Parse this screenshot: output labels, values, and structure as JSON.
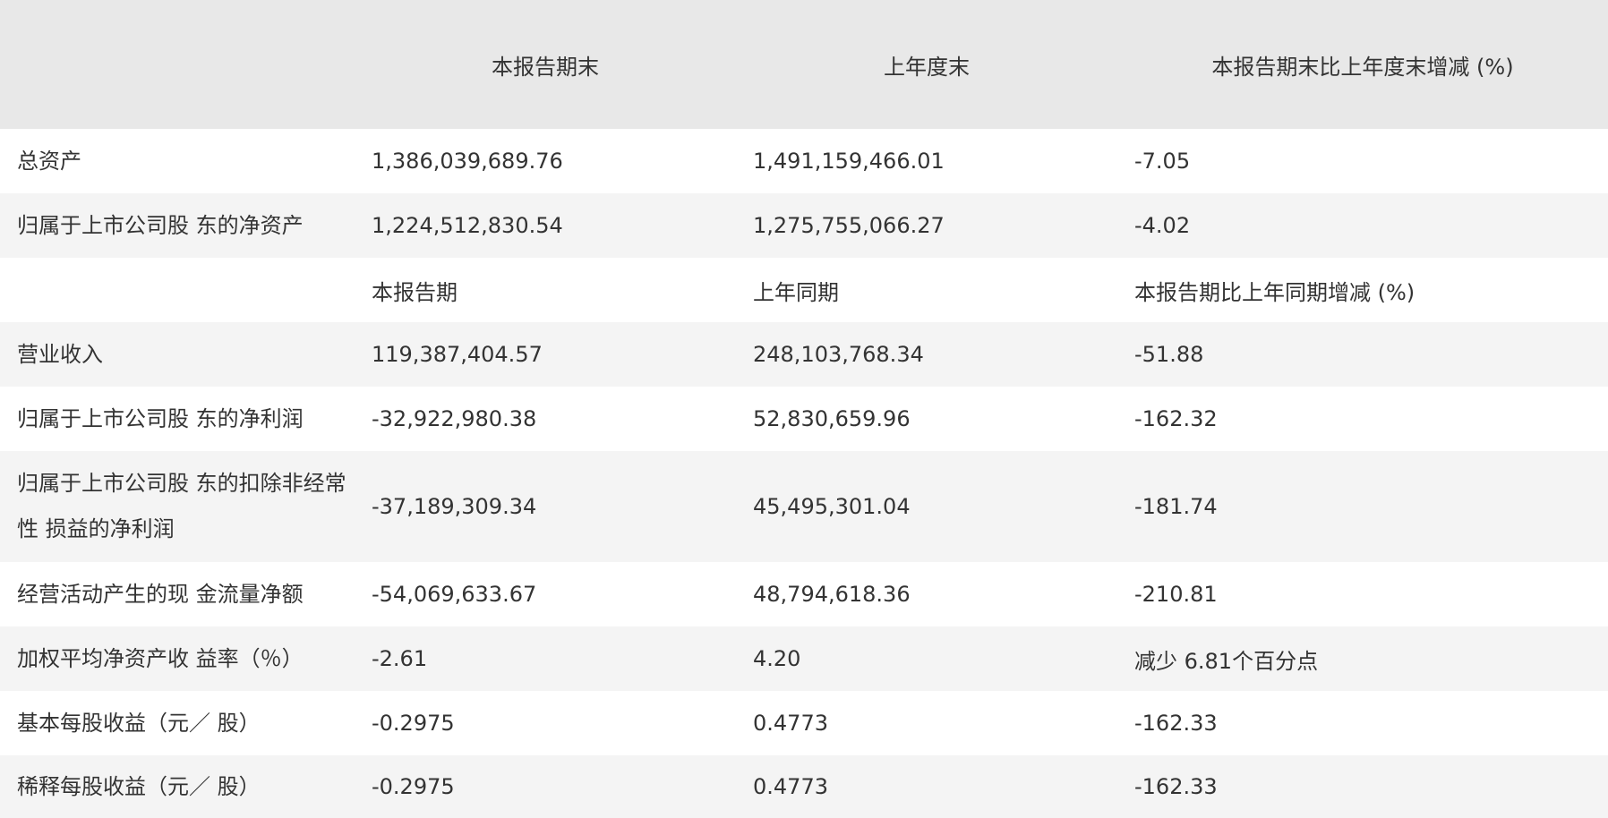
{
  "header": {
    "col1": "",
    "col2": "本报告期末",
    "col3": "上年度末",
    "col4": "本报告期末比上年度末增减 (%)"
  },
  "rows": [
    {
      "label": "总资产",
      "v1": "1,386,039,689.76",
      "v2": "1,491,159,466.01",
      "v3": "-7.05"
    },
    {
      "label": "归属于上市公司股 东的净资产",
      "v1": "1,224,512,830.54",
      "v2": "1,275,755,066.27",
      "v3": "-4.02"
    },
    {
      "label": "",
      "v1": "本报告期",
      "v2": "上年同期",
      "v3": "本报告期比上年同期增减 (%)"
    },
    {
      "label": "营业收入",
      "v1": "119,387,404.57",
      "v2": "248,103,768.34",
      "v3": "-51.88"
    },
    {
      "label": "归属于上市公司股 东的净利润",
      "v1": "-32,922,980.38",
      "v2": "52,830,659.96",
      "v3": "-162.32"
    },
    {
      "label": "归属于上市公司股 东的扣除非经常性 损益的净利润",
      "v1": "-37,189,309.34",
      "v2": "45,495,301.04",
      "v3": "-181.74"
    },
    {
      "label": "经营活动产生的现 金流量净额",
      "v1": "-54,069,633.67",
      "v2": "48,794,618.36",
      "v3": "-210.81"
    },
    {
      "label": "加权平均净资产收 益率（％）",
      "v1": "-2.61",
      "v2": "4.20",
      "v3": "减少 6.81个百分点"
    },
    {
      "label": "基本每股收益（元／ 股）",
      "v1": "-0.2975",
      "v2": "0.4773",
      "v3": "-162.33"
    },
    {
      "label": "稀释每股收益（元／ 股）",
      "v1": "-0.2975",
      "v2": "0.4773",
      "v3": "-162.33"
    }
  ]
}
